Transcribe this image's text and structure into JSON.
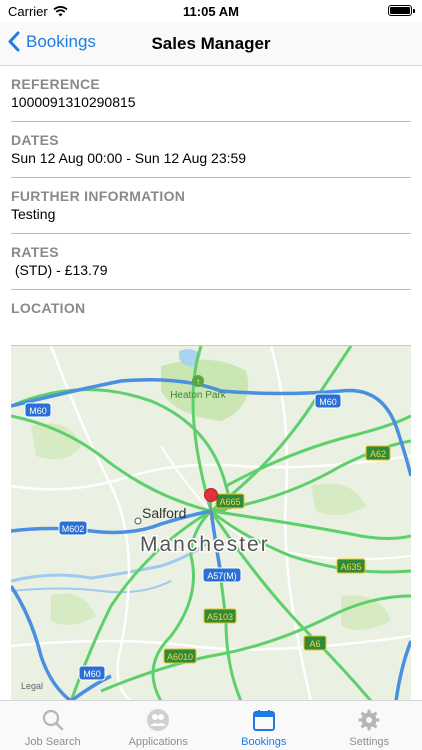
{
  "status_bar": {
    "carrier": "Carrier",
    "time": "11:05 AM"
  },
  "nav": {
    "back_label": "Bookings",
    "title": "Sales Manager"
  },
  "sections": [
    {
      "label": "REFERENCE",
      "value": "1000091310290815"
    },
    {
      "label": "DATES",
      "value": "Sun 12 Aug 00:00 - Sun 12 Aug 23:59"
    },
    {
      "label": "FURTHER INFORMATION",
      "value": "Testing"
    },
    {
      "label": "RATES",
      "value": " (STD) - £13.79"
    },
    {
      "label": "LOCATION"
    }
  ],
  "map": {
    "city": "Manchester",
    "places": [
      "Salford",
      "Heaton Park"
    ],
    "road_labels": [
      "M60",
      "M60",
      "A62",
      "A665",
      "M602",
      "A57(M)",
      "A635",
      "A5103",
      "A6",
      "A6010",
      "M60"
    ],
    "legal": "Legal"
  },
  "tabs": [
    {
      "label": "Job Search",
      "icon": "search-icon",
      "active": false
    },
    {
      "label": "Applications",
      "icon": "people-icon",
      "active": false
    },
    {
      "label": "Bookings",
      "icon": "calendar-icon",
      "active": true
    },
    {
      "label": "Settings",
      "icon": "gear-icon",
      "active": false
    }
  ],
  "colors": {
    "accent": "#1f7ce4",
    "inactive": "#8e8e93",
    "motorway": "#4a8fe0",
    "a_road": "#5ed06b"
  }
}
